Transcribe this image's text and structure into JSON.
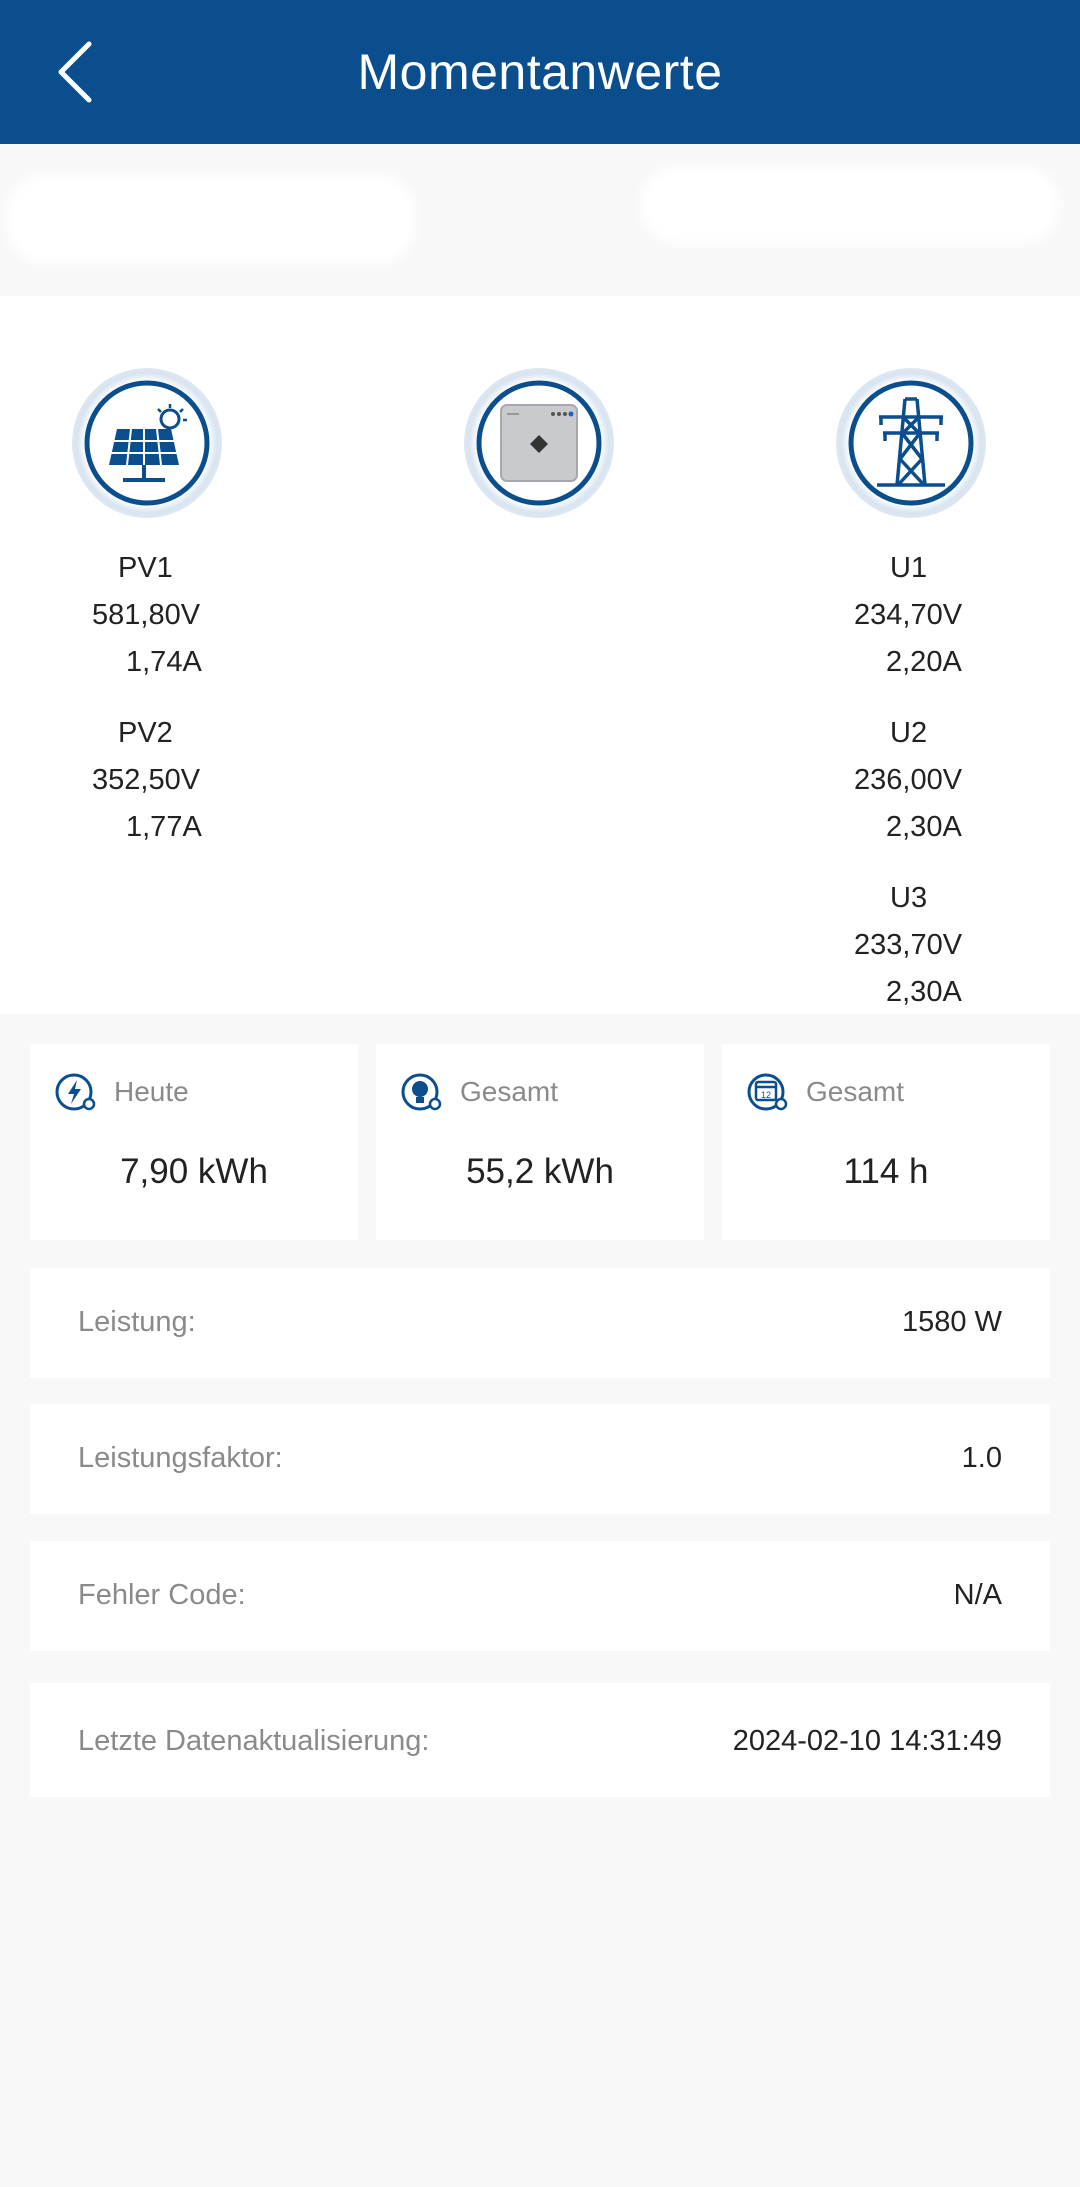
{
  "header": {
    "title": "Momentanwerte"
  },
  "pv": [
    {
      "name": "PV1",
      "voltage": "581,80V",
      "current": "1,74A"
    },
    {
      "name": "PV2",
      "voltage": "352,50V",
      "current": "1,77A"
    }
  ],
  "grid": [
    {
      "name": "U1",
      "voltage": "234,70V",
      "current": "2,20A"
    },
    {
      "name": "U2",
      "voltage": "236,00V",
      "current": "2,30A"
    },
    {
      "name": "U3",
      "voltage": "233,70V",
      "current": "2,30A"
    }
  ],
  "cards": [
    {
      "label": "Heute",
      "value": "7,90 kWh",
      "icon": "lightning-icon"
    },
    {
      "label": "Gesamt",
      "value": "55,2 kWh",
      "icon": "lightbulb-icon"
    },
    {
      "label": "Gesamt",
      "value": "114 h",
      "icon": "calendar-icon"
    }
  ],
  "rows": [
    {
      "label": "Leistung:",
      "value": "1580 W"
    },
    {
      "label": "Leistungsfaktor:",
      "value": "1.0"
    },
    {
      "label": "Fehler Code:",
      "value": "N/A"
    },
    {
      "label": "Letzte Datenaktualisierung:",
      "value": "2024-02-10 14:31:49"
    }
  ],
  "colors": {
    "header_bg": "#0a4e8e",
    "accent": "#0a4e8e",
    "label_gray": "#8a8a8a"
  }
}
